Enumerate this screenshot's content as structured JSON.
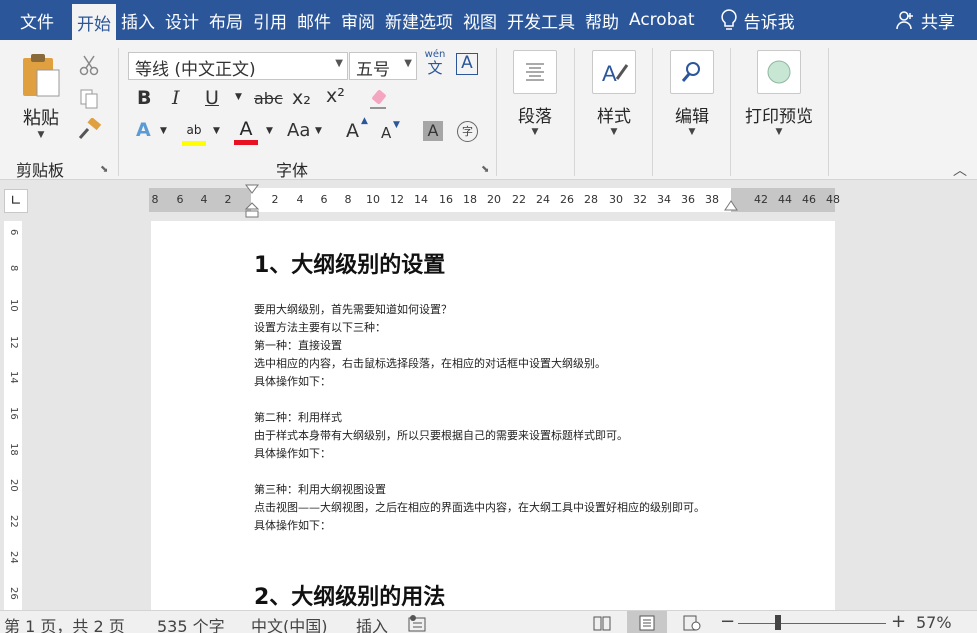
{
  "tabs": {
    "file": "文件",
    "items": [
      "开始",
      "插入",
      "设计",
      "布局",
      "引用",
      "邮件",
      "审阅",
      "新建选项",
      "视图",
      "开发工具",
      "帮助",
      "Acrobat"
    ],
    "active_index": 0,
    "tell_me": "告诉我",
    "share": "共享"
  },
  "ribbon": {
    "paste_label": "粘贴",
    "clipboard_group": "剪贴板",
    "font_name": "等线 (中文正文)",
    "font_size": "五号",
    "phonetic_top": "wén",
    "phonetic_char": "文",
    "border_char": "A",
    "bold": "B",
    "italic": "I",
    "underline": "U",
    "strike": "abc",
    "subscript": "x₂",
    "superscript": "x²",
    "font_group": "字体",
    "paragraph_label": "段落",
    "styles_label": "样式",
    "editing_label": "编辑",
    "print_preview_label": "打印预览",
    "text_effects": "A",
    "highlight": "ab",
    "font_color": "A",
    "change_case": "Aa",
    "grow_font": "A",
    "shrink_font": "A",
    "char_shading": "A",
    "enclosed_char": "字"
  },
  "ruler": {
    "numbers": [
      "8",
      "6",
      "4",
      "2",
      "2",
      "4",
      "6",
      "8",
      "10",
      "12",
      "14",
      "16",
      "18",
      "20",
      "22",
      "24",
      "26",
      "28",
      "30",
      "32",
      "34",
      "36",
      "38",
      "42",
      "44",
      "46",
      "48"
    ],
    "vertical_numbers": [
      "6",
      "8",
      "10",
      "12",
      "14",
      "16",
      "18",
      "20",
      "22",
      "24",
      "26"
    ]
  },
  "document": {
    "heading1": "1、大纲级别的设置",
    "paragraphs": [
      "要用大纲级别，首先需要知道如何设置？",
      "设置方法主要有以下三种：",
      "第一种：直接设置",
      "选中相应的内容，右击鼠标选择段落，在相应的对话框中设置大纲级别。",
      "具体操作如下：",
      "",
      "第二种：利用样式",
      "由于样式本身带有大纲级别，所以只要根据自己的需要来设置标题样式即可。",
      "具体操作如下：",
      "",
      "第三种：利用大纲视图设置",
      "点击视图——大纲视图，之后在相应的界面选中内容，在大纲工具中设置好相应的级别即可。",
      "具体操作如下："
    ],
    "heading2": "2、大纲级别的用法"
  },
  "status": {
    "page": "第 1 页，共 2 页",
    "words": "535 个字",
    "language": "中文(中国)",
    "insert_mode": "插入",
    "zoom_minus": "−",
    "zoom_plus": "+",
    "zoom": "57%"
  },
  "colors": {
    "tabbar": "#2b579a",
    "highlight_yellow": "#ffff00",
    "font_red": "#e81123"
  }
}
